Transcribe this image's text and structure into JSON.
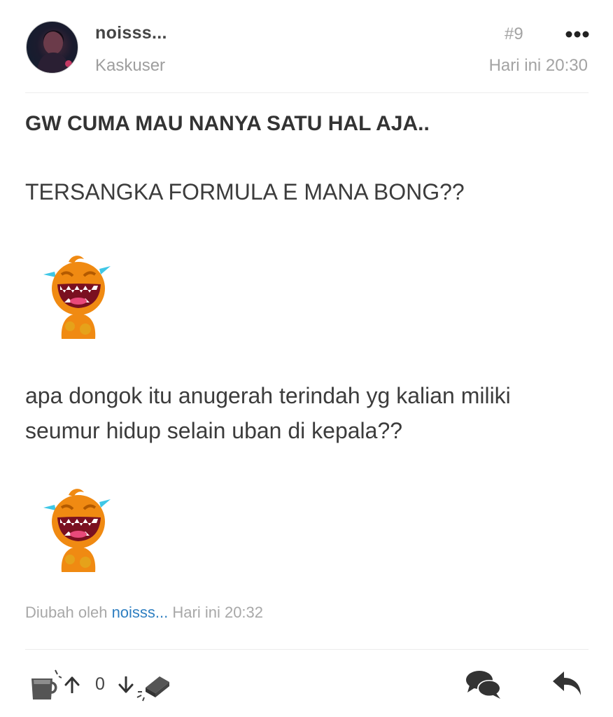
{
  "post": {
    "username": "noisss...",
    "rank": "Kaskuser",
    "number": "#9",
    "timestamp": "Hari ini 20:30",
    "title_line": "GW CUMA MAU NANYA SATU HAL AJA..",
    "line1": "TERSANGKA FORMULA E MANA BONG??",
    "line2": "apa dongok itu anugerah terindah yg kalian miliki seumur hidup selain uban di kepala??",
    "edited_prefix": "Diubah oleh",
    "edited_user": "noisss...",
    "edited_time": "Hari ini 20:32"
  },
  "actions": {
    "vote_count": "0",
    "icons": [
      "cendol-icon",
      "upvote-icon",
      "downvote-icon",
      "bata-icon",
      "quote-icon",
      "reply-icon"
    ]
  },
  "colors": {
    "link": "#2f7fc1",
    "muted": "#a3a3a3",
    "text": "#3c3c3c",
    "emoticon_orange": "#f08a12"
  }
}
